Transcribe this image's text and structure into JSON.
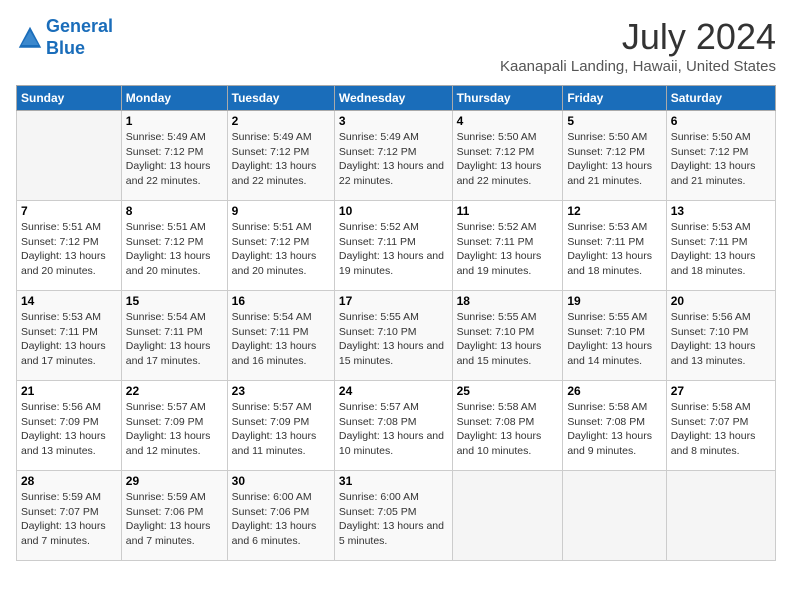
{
  "header": {
    "logo_line1": "General",
    "logo_line2": "Blue",
    "month_year": "July 2024",
    "location": "Kaanapali Landing, Hawaii, United States"
  },
  "days_of_week": [
    "Sunday",
    "Monday",
    "Tuesday",
    "Wednesday",
    "Thursday",
    "Friday",
    "Saturday"
  ],
  "weeks": [
    [
      {
        "day": "",
        "sunrise": "",
        "sunset": "",
        "daylight": ""
      },
      {
        "day": "1",
        "sunrise": "Sunrise: 5:49 AM",
        "sunset": "Sunset: 7:12 PM",
        "daylight": "Daylight: 13 hours and 22 minutes."
      },
      {
        "day": "2",
        "sunrise": "Sunrise: 5:49 AM",
        "sunset": "Sunset: 7:12 PM",
        "daylight": "Daylight: 13 hours and 22 minutes."
      },
      {
        "day": "3",
        "sunrise": "Sunrise: 5:49 AM",
        "sunset": "Sunset: 7:12 PM",
        "daylight": "Daylight: 13 hours and 22 minutes."
      },
      {
        "day": "4",
        "sunrise": "Sunrise: 5:50 AM",
        "sunset": "Sunset: 7:12 PM",
        "daylight": "Daylight: 13 hours and 22 minutes."
      },
      {
        "day": "5",
        "sunrise": "Sunrise: 5:50 AM",
        "sunset": "Sunset: 7:12 PM",
        "daylight": "Daylight: 13 hours and 21 minutes."
      },
      {
        "day": "6",
        "sunrise": "Sunrise: 5:50 AM",
        "sunset": "Sunset: 7:12 PM",
        "daylight": "Daylight: 13 hours and 21 minutes."
      }
    ],
    [
      {
        "day": "7",
        "sunrise": "Sunrise: 5:51 AM",
        "sunset": "Sunset: 7:12 PM",
        "daylight": "Daylight: 13 hours and 20 minutes."
      },
      {
        "day": "8",
        "sunrise": "Sunrise: 5:51 AM",
        "sunset": "Sunset: 7:12 PM",
        "daylight": "Daylight: 13 hours and 20 minutes."
      },
      {
        "day": "9",
        "sunrise": "Sunrise: 5:51 AM",
        "sunset": "Sunset: 7:12 PM",
        "daylight": "Daylight: 13 hours and 20 minutes."
      },
      {
        "day": "10",
        "sunrise": "Sunrise: 5:52 AM",
        "sunset": "Sunset: 7:11 PM",
        "daylight": "Daylight: 13 hours and 19 minutes."
      },
      {
        "day": "11",
        "sunrise": "Sunrise: 5:52 AM",
        "sunset": "Sunset: 7:11 PM",
        "daylight": "Daylight: 13 hours and 19 minutes."
      },
      {
        "day": "12",
        "sunrise": "Sunrise: 5:53 AM",
        "sunset": "Sunset: 7:11 PM",
        "daylight": "Daylight: 13 hours and 18 minutes."
      },
      {
        "day": "13",
        "sunrise": "Sunrise: 5:53 AM",
        "sunset": "Sunset: 7:11 PM",
        "daylight": "Daylight: 13 hours and 18 minutes."
      }
    ],
    [
      {
        "day": "14",
        "sunrise": "Sunrise: 5:53 AM",
        "sunset": "Sunset: 7:11 PM",
        "daylight": "Daylight: 13 hours and 17 minutes."
      },
      {
        "day": "15",
        "sunrise": "Sunrise: 5:54 AM",
        "sunset": "Sunset: 7:11 PM",
        "daylight": "Daylight: 13 hours and 17 minutes."
      },
      {
        "day": "16",
        "sunrise": "Sunrise: 5:54 AM",
        "sunset": "Sunset: 7:11 PM",
        "daylight": "Daylight: 13 hours and 16 minutes."
      },
      {
        "day": "17",
        "sunrise": "Sunrise: 5:55 AM",
        "sunset": "Sunset: 7:10 PM",
        "daylight": "Daylight: 13 hours and 15 minutes."
      },
      {
        "day": "18",
        "sunrise": "Sunrise: 5:55 AM",
        "sunset": "Sunset: 7:10 PM",
        "daylight": "Daylight: 13 hours and 15 minutes."
      },
      {
        "day": "19",
        "sunrise": "Sunrise: 5:55 AM",
        "sunset": "Sunset: 7:10 PM",
        "daylight": "Daylight: 13 hours and 14 minutes."
      },
      {
        "day": "20",
        "sunrise": "Sunrise: 5:56 AM",
        "sunset": "Sunset: 7:10 PM",
        "daylight": "Daylight: 13 hours and 13 minutes."
      }
    ],
    [
      {
        "day": "21",
        "sunrise": "Sunrise: 5:56 AM",
        "sunset": "Sunset: 7:09 PM",
        "daylight": "Daylight: 13 hours and 13 minutes."
      },
      {
        "day": "22",
        "sunrise": "Sunrise: 5:57 AM",
        "sunset": "Sunset: 7:09 PM",
        "daylight": "Daylight: 13 hours and 12 minutes."
      },
      {
        "day": "23",
        "sunrise": "Sunrise: 5:57 AM",
        "sunset": "Sunset: 7:09 PM",
        "daylight": "Daylight: 13 hours and 11 minutes."
      },
      {
        "day": "24",
        "sunrise": "Sunrise: 5:57 AM",
        "sunset": "Sunset: 7:08 PM",
        "daylight": "Daylight: 13 hours and 10 minutes."
      },
      {
        "day": "25",
        "sunrise": "Sunrise: 5:58 AM",
        "sunset": "Sunset: 7:08 PM",
        "daylight": "Daylight: 13 hours and 10 minutes."
      },
      {
        "day": "26",
        "sunrise": "Sunrise: 5:58 AM",
        "sunset": "Sunset: 7:08 PM",
        "daylight": "Daylight: 13 hours and 9 minutes."
      },
      {
        "day": "27",
        "sunrise": "Sunrise: 5:58 AM",
        "sunset": "Sunset: 7:07 PM",
        "daylight": "Daylight: 13 hours and 8 minutes."
      }
    ],
    [
      {
        "day": "28",
        "sunrise": "Sunrise: 5:59 AM",
        "sunset": "Sunset: 7:07 PM",
        "daylight": "Daylight: 13 hours and 7 minutes."
      },
      {
        "day": "29",
        "sunrise": "Sunrise: 5:59 AM",
        "sunset": "Sunset: 7:06 PM",
        "daylight": "Daylight: 13 hours and 7 minutes."
      },
      {
        "day": "30",
        "sunrise": "Sunrise: 6:00 AM",
        "sunset": "Sunset: 7:06 PM",
        "daylight": "Daylight: 13 hours and 6 minutes."
      },
      {
        "day": "31",
        "sunrise": "Sunrise: 6:00 AM",
        "sunset": "Sunset: 7:05 PM",
        "daylight": "Daylight: 13 hours and 5 minutes."
      },
      {
        "day": "",
        "sunrise": "",
        "sunset": "",
        "daylight": ""
      },
      {
        "day": "",
        "sunrise": "",
        "sunset": "",
        "daylight": ""
      },
      {
        "day": "",
        "sunrise": "",
        "sunset": "",
        "daylight": ""
      }
    ]
  ]
}
